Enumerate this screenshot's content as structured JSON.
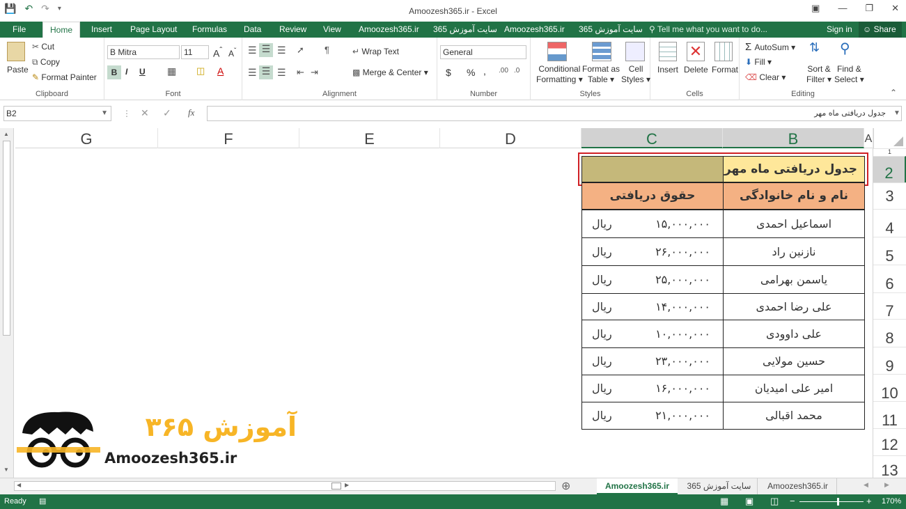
{
  "title": "Amoozesh365.ir - Excel",
  "tabs": [
    "File",
    "Home",
    "Insert",
    "Page Layout",
    "Formulas",
    "Data",
    "Review",
    "View",
    "Amoozesh365.ir",
    "سایت آموزش 365",
    "Amoozesh365.ir",
    "سایت آموزش 365"
  ],
  "tell_me": "Tell me what you want to do...",
  "sign_in": "Sign in",
  "share": "Share",
  "clipboard": {
    "paste": "Paste",
    "cut": "Cut",
    "copy": "Copy",
    "format_painter": "Format Painter",
    "label": "Clipboard"
  },
  "font": {
    "name": "B Mitra",
    "size": "11",
    "label": "Font"
  },
  "alignment": {
    "wrap": "Wrap Text",
    "merge": "Merge & Center",
    "label": "Alignment"
  },
  "number": {
    "format": "General",
    "label": "Number",
    "dollar": "$",
    "percent": "%",
    "comma": ","
  },
  "styles": {
    "conditional": "Conditional",
    "conditional2": "Formatting",
    "format_as": "Format as",
    "format_as2": "Table",
    "cell": "Cell",
    "cell2": "Styles",
    "label": "Styles"
  },
  "cells": {
    "insert": "Insert",
    "delete": "Delete",
    "format": "Format",
    "label": "Cells"
  },
  "editing": {
    "autosum": "AutoSum",
    "fill": "Fill",
    "clear": "Clear",
    "sort": "Sort &",
    "sort2": "Filter",
    "find": "Find &",
    "find2": "Select",
    "label": "Editing"
  },
  "namebox": "B2",
  "formula": "جدول دریافتی ماه مهر",
  "columns": [
    "G",
    "F",
    "E",
    "D",
    "C",
    "B",
    "A"
  ],
  "rows": [
    "1",
    "2",
    "3",
    "4",
    "5",
    "6",
    "7",
    "8",
    "9",
    "10",
    "11",
    "12",
    "13"
  ],
  "table": {
    "title": "جدول دریافتی ماه مهر",
    "header_name": "نام و نام خانوادگی",
    "header_salary": "حقوق دریافتی",
    "currency": "ریال",
    "entries": [
      {
        "name": "اسماعیل احمدی",
        "amount": "۱۵,۰۰۰,۰۰۰"
      },
      {
        "name": "نازنین راد",
        "amount": "۲۶,۰۰۰,۰۰۰"
      },
      {
        "name": "یاسمن بهرامی",
        "amount": "۲۵,۰۰۰,۰۰۰"
      },
      {
        "name": "علی رضا احمدی",
        "amount": "۱۴,۰۰۰,۰۰۰"
      },
      {
        "name": "علی داوودی",
        "amount": "۱۰,۰۰۰,۰۰۰"
      },
      {
        "name": "حسین مولایی",
        "amount": "۲۳,۰۰۰,۰۰۰"
      },
      {
        "name": "امیر علی امیدیان",
        "amount": "۱۶,۰۰۰,۰۰۰"
      },
      {
        "name": "محمد اقبالی",
        "amount": "۲۱,۰۰۰,۰۰۰"
      }
    ]
  },
  "logo": {
    "fa": "آموزش ۳۶۵",
    "en": "Amoozesh365.ir"
  },
  "sheet_tabs": [
    "Amoozesh365.ir",
    "سایت آموزش 365",
    "Amoozesh365.ir"
  ],
  "status": {
    "ready": "Ready",
    "zoom": "170%"
  },
  "colors": {
    "excel_green": "#217346",
    "title_fill": "#fee79a",
    "merged_fill": "#c5b87a",
    "header_fill": "#f4b183",
    "selection_border": "#d02024"
  }
}
